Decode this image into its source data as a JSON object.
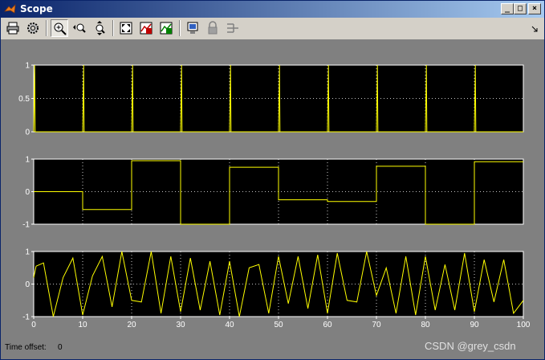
{
  "window": {
    "title": "Scope"
  },
  "toolbar": {
    "items": [
      {
        "name": "print",
        "icon": "printer-icon"
      },
      {
        "name": "parameters",
        "icon": "gear-icon"
      },
      {
        "name": "zoom",
        "icon": "zoom-in-icon",
        "active": true
      },
      {
        "name": "zoom-x",
        "icon": "zoom-x-axis-icon"
      },
      {
        "name": "zoom-y",
        "icon": "zoom-y-axis-icon"
      },
      {
        "name": "autoscale",
        "icon": "autoscale-icon"
      },
      {
        "name": "save-axes",
        "icon": "save-axes-settings-icon"
      },
      {
        "name": "restore-axes",
        "icon": "restore-axes-settings-icon"
      },
      {
        "name": "floating-scope",
        "icon": "floating-scope-icon"
      },
      {
        "name": "lock-axes",
        "icon": "lock-icon"
      },
      {
        "name": "signal-selector",
        "icon": "signal-selector-icon"
      }
    ]
  },
  "footer": {
    "time_offset_label": "Time offset:",
    "time_offset_value": "0"
  },
  "watermark": "CSDN @grey_csdn",
  "colors": {
    "background": "#808080",
    "axes_bg": "#000000",
    "trace": "#ffff00",
    "axes_border": "#ffffff",
    "grid": "#ffffff"
  },
  "chart_data": [
    {
      "type": "line",
      "title": "",
      "xlim": [
        0,
        100
      ],
      "ylim": [
        0,
        1
      ],
      "yticks": [
        "0",
        "0.5",
        "1"
      ],
      "xticks": [],
      "grid": true,
      "series": [
        {
          "x": [
            0,
            0.2,
            0.3,
            10,
            10.2,
            10.3,
            20,
            20.2,
            20.3,
            30,
            30.2,
            30.3,
            40,
            40.2,
            40.3,
            50,
            50.2,
            50.3,
            60,
            60.2,
            60.3,
            70,
            70.2,
            70.3,
            80,
            80.2,
            80.3,
            90,
            90.2,
            90.3,
            100
          ],
          "y": [
            0,
            1,
            0,
            0,
            1,
            0,
            0,
            1,
            0,
            0,
            1,
            0,
            0,
            1,
            0,
            0,
            1,
            0,
            0,
            1,
            0,
            0,
            1,
            0,
            0,
            1,
            0,
            0,
            1,
            0,
            0
          ]
        }
      ]
    },
    {
      "type": "line",
      "title": "",
      "xlim": [
        0,
        100
      ],
      "ylim": [
        -1,
        1
      ],
      "yticks": [
        "-1",
        "0",
        "1"
      ],
      "xticks": [],
      "grid": true,
      "series": [
        {
          "x": [
            0,
            10,
            10,
            20,
            20,
            30,
            30,
            40,
            40,
            50,
            50,
            60,
            60,
            70,
            70,
            80,
            80,
            90,
            90,
            100
          ],
          "y": [
            0,
            0,
            -0.55,
            -0.55,
            0.95,
            0.95,
            -1,
            -1,
            0.75,
            0.75,
            -0.25,
            -0.25,
            -0.3,
            -0.3,
            0.78,
            0.78,
            -1,
            -1,
            0.92,
            0.92
          ]
        }
      ]
    },
    {
      "type": "line",
      "title": "",
      "xlim": [
        0,
        100
      ],
      "ylim": [
        -1,
        1
      ],
      "yticks": [
        "-1",
        "0",
        "1"
      ],
      "xticks": [
        "0",
        "10",
        "20",
        "30",
        "40",
        "50",
        "60",
        "70",
        "80",
        "90",
        "100"
      ],
      "grid": true,
      "series": [
        {
          "x": [
            0,
            0.5,
            2,
            4,
            6,
            8,
            10,
            12,
            14,
            16,
            18,
            20,
            22,
            24,
            26,
            28,
            30,
            32,
            34,
            36,
            38,
            40,
            42,
            44,
            46,
            48,
            50,
            52,
            54,
            56,
            58,
            60,
            62,
            64,
            66,
            68,
            70,
            72,
            74,
            76,
            78,
            80,
            82,
            84,
            86,
            88,
            90,
            92,
            94,
            96,
            98,
            100
          ],
          "y": [
            0.2,
            0.55,
            0.65,
            -1,
            0.2,
            0.8,
            -0.95,
            0.25,
            0.85,
            -0.7,
            1.0,
            -0.5,
            -0.55,
            1.0,
            -0.9,
            0.85,
            -0.85,
            0.8,
            -0.8,
            0.7,
            -0.95,
            0.7,
            -1,
            0.5,
            0.6,
            -0.9,
            0.85,
            -0.6,
            0.85,
            -0.75,
            0.9,
            -0.9,
            0.95,
            -0.5,
            -0.55,
            1.0,
            -0.35,
            0.5,
            -0.9,
            0.85,
            -0.95,
            0.85,
            -0.8,
            0.6,
            -0.8,
            0.95,
            -0.85,
            0.75,
            -0.55,
            0.75,
            -0.9,
            -0.5
          ]
        }
      ]
    }
  ]
}
